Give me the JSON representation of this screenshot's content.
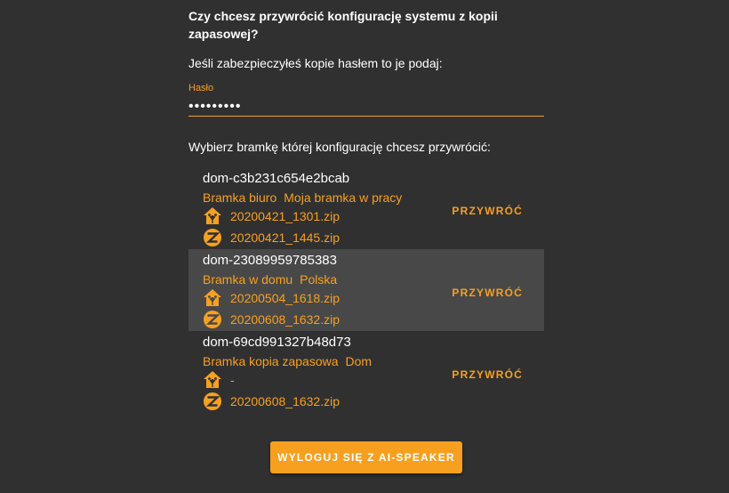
{
  "question": "Czy chcesz przywrócić konfigurację systemu z kopii zapasowej?",
  "password_hint": "Jeśli zabezpieczyłeś kopie hasłem to je podaj:",
  "password_field": {
    "label": "Hasło",
    "value": "•••••••••"
  },
  "choose_label": "Wybierz bramkę której konfigurację chcesz przywrócić:",
  "gateways": [
    {
      "id": "dom-c3b231c654e2bcab",
      "names": [
        "Bramka biuro",
        "Moja bramka w pracy"
      ],
      "files": [
        {
          "icon": "home-assistant-icon",
          "name": "20200421_1301.zip"
        },
        {
          "icon": "zigbee-icon",
          "name": "20200421_1445.zip"
        }
      ],
      "restore_label": "PRZYWRÓĆ",
      "selected": false
    },
    {
      "id": "dom-23089959785383",
      "names": [
        "Bramka w domu",
        "Polska"
      ],
      "files": [
        {
          "icon": "home-assistant-icon",
          "name": "20200504_1618.zip"
        },
        {
          "icon": "zigbee-icon",
          "name": "20200608_1632.zip"
        }
      ],
      "restore_label": "PRZYWRÓĆ",
      "selected": true
    },
    {
      "id": "dom-69cd991327b48d73",
      "names": [
        "Bramka kopia zapasowa",
        "Dom"
      ],
      "files": [
        {
          "icon": "home-assistant-icon",
          "name": "-"
        },
        {
          "icon": "zigbee-icon",
          "name": "20200608_1632.zip"
        }
      ],
      "restore_label": "PRZYWRÓĆ",
      "selected": false
    }
  ],
  "logout_label": "WYLOGUJ SIĘ Z AI-SPEAKER",
  "colors": {
    "background": "#303030",
    "accent": "#f7a01f",
    "selected_row": "#484848"
  }
}
